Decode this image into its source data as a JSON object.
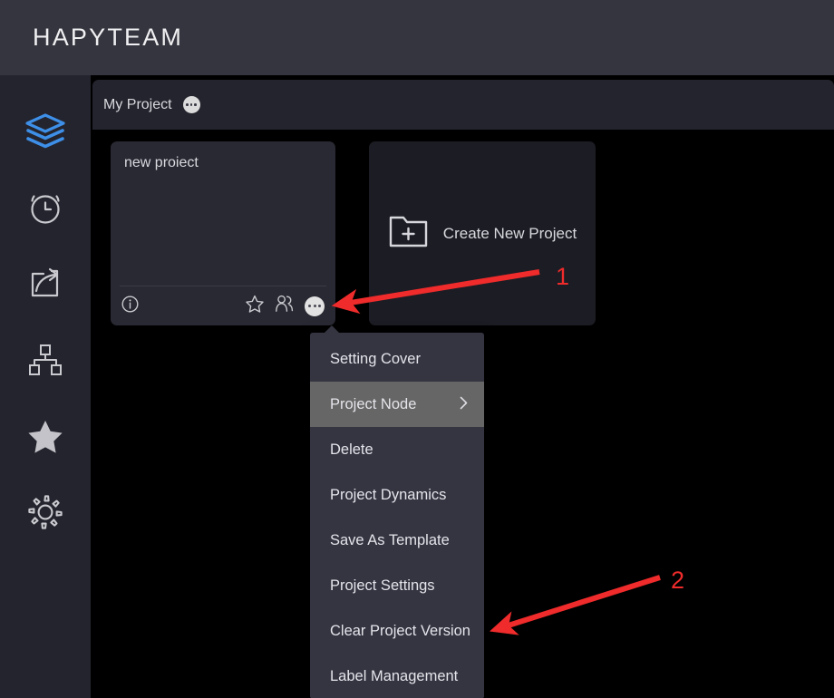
{
  "header": {
    "brand": "HAPYTEAM"
  },
  "sidebar": {
    "items": [
      {
        "icon": "layers-icon",
        "name": "sidebar-item-layers",
        "active": true
      },
      {
        "icon": "alarm-clock-icon",
        "name": "sidebar-item-alarm",
        "active": false
      },
      {
        "icon": "share-export-icon",
        "name": "sidebar-item-share",
        "active": false
      },
      {
        "icon": "org-chart-icon",
        "name": "sidebar-item-org-chart",
        "active": false
      },
      {
        "icon": "star-filled-icon",
        "name": "sidebar-item-favorites",
        "active": false
      },
      {
        "icon": "gear-icon",
        "name": "sidebar-item-settings",
        "active": false
      }
    ]
  },
  "tabbar": {
    "label": "My Project",
    "more_icon": "three-dots-icon"
  },
  "cards": {
    "project": {
      "title": "new proiect",
      "footer": {
        "info_icon": "info-circle-icon",
        "star_icon": "star-outline-icon",
        "members_icon": "users-icon",
        "more_icon": "three-dots-icon"
      }
    },
    "create": {
      "label": "Create New Project",
      "icon": "folder-plus-icon"
    }
  },
  "context_menu": {
    "items": [
      {
        "label": "Setting Cover",
        "active": false,
        "has_submenu": false
      },
      {
        "label": "Project Node",
        "active": true,
        "has_submenu": true
      },
      {
        "label": "Delete",
        "active": false,
        "has_submenu": false
      },
      {
        "label": "Project Dynamics",
        "active": false,
        "has_submenu": false
      },
      {
        "label": "Save As Template",
        "active": false,
        "has_submenu": false
      },
      {
        "label": "Project Settings",
        "active": false,
        "has_submenu": false
      },
      {
        "label": "Clear Project Version",
        "active": false,
        "has_submenu": false
      },
      {
        "label": "Label Management",
        "active": false,
        "has_submenu": false
      }
    ],
    "submenu_chevron": "chevron-right-icon"
  },
  "annotations": {
    "color": "#ef2b2b",
    "markers": [
      {
        "label": "1",
        "target": "project-card-more-button"
      },
      {
        "label": "2",
        "target": "context-menu-item-clear-project-version"
      }
    ]
  },
  "colors": {
    "page_background": "#000000",
    "topbar": "#35353f",
    "sidebar": "#24242e",
    "card": "#292933",
    "menu": "#353542",
    "menu_highlight": "#666666",
    "accent_blue": "#3d8fe8",
    "text": "#e4e4ea"
  }
}
